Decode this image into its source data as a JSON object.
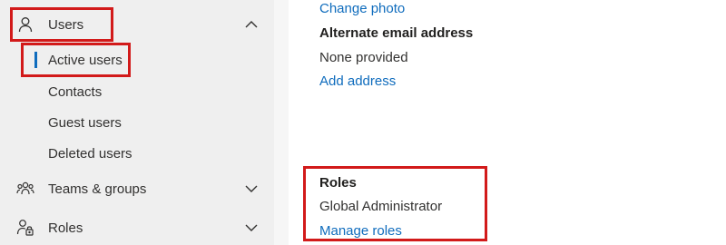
{
  "sidebar": {
    "users": {
      "label": "Users",
      "icon": "person-icon",
      "chevron": "chevron-up-icon"
    },
    "subitems": [
      {
        "label": "Active users",
        "active": true
      },
      {
        "label": "Contacts"
      },
      {
        "label": "Guest users"
      },
      {
        "label": "Deleted users"
      }
    ],
    "teams": {
      "label": "Teams & groups",
      "icon": "people-group-icon",
      "chevron": "chevron-down-icon"
    },
    "roles": {
      "label": "Roles",
      "icon": "person-key-icon",
      "chevron": "chevron-down-icon"
    }
  },
  "details": {
    "change_photo": "Change photo",
    "alt_email_heading": "Alternate email address",
    "alt_email_value": "None provided",
    "add_address": "Add address",
    "roles_heading": "Roles",
    "roles_value": "Global Administrator",
    "manage_roles": "Manage roles"
  },
  "colors": {
    "accent": "#0f6cbd",
    "highlight": "#d21a1a",
    "sidebar_bg": "#efefef"
  }
}
